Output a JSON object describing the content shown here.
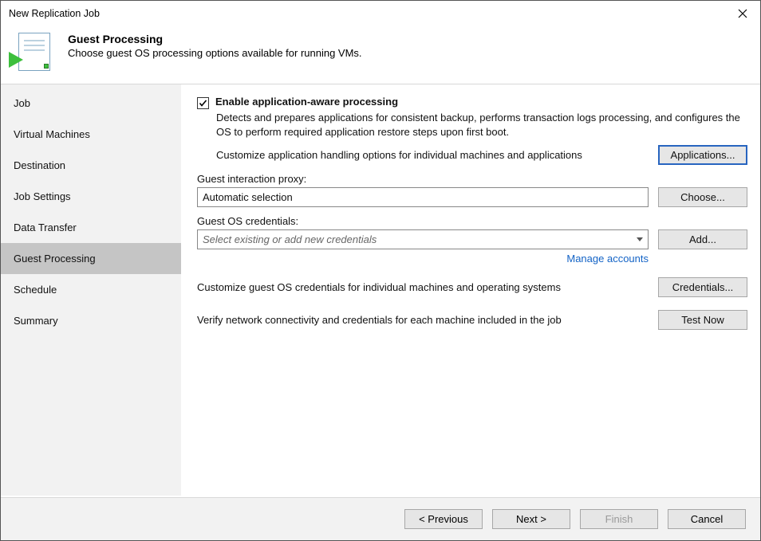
{
  "window": {
    "title": "New Replication Job"
  },
  "header": {
    "title": "Guest Processing",
    "subtitle": "Choose guest OS processing options available for running VMs."
  },
  "nav": {
    "items": [
      {
        "label": "Job"
      },
      {
        "label": "Virtual Machines"
      },
      {
        "label": "Destination"
      },
      {
        "label": "Job Settings"
      },
      {
        "label": "Data Transfer"
      },
      {
        "label": "Guest Processing"
      },
      {
        "label": "Schedule"
      },
      {
        "label": "Summary"
      }
    ],
    "selected_index": 5
  },
  "content": {
    "enable_checkbox": {
      "checked": true,
      "label": "Enable application-aware processing"
    },
    "enable_description": "Detects and prepares applications for consistent backup, performs transaction logs processing, and configures the OS to perform required application restore steps upon first boot.",
    "applications_label": "Customize application handling options for individual machines and applications",
    "applications_button": "Applications...",
    "proxy_label": "Guest interaction proxy:",
    "proxy_value": "Automatic selection",
    "choose_button": "Choose...",
    "creds_label": "Guest OS credentials:",
    "creds_placeholder": "Select existing or add new credentials",
    "add_button": "Add...",
    "manage_link": "Manage accounts",
    "credentials_label": "Customize guest OS credentials for individual machines and operating systems",
    "credentials_button": "Credentials...",
    "test_label": "Verify network connectivity and credentials for each machine included in the job",
    "test_button": "Test Now"
  },
  "footer": {
    "previous": "< Previous",
    "next": "Next >",
    "finish": "Finish",
    "cancel": "Cancel"
  }
}
